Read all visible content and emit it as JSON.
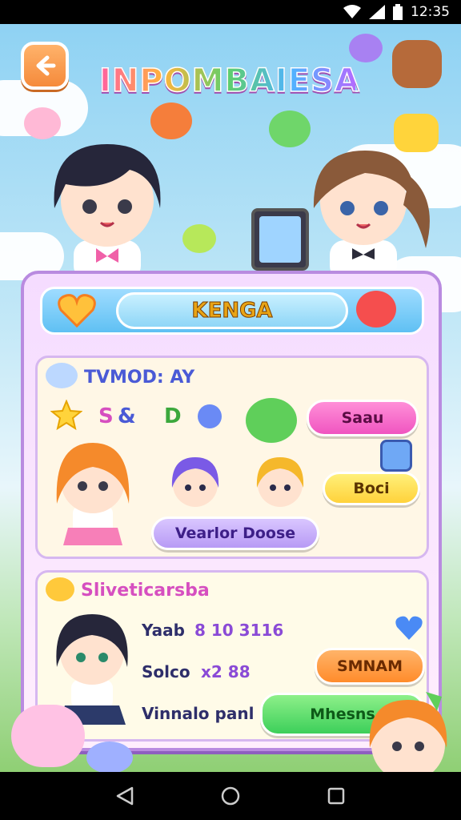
{
  "status_bar": {
    "time": "12:35"
  },
  "header": {
    "title": "INPOMBAIESA"
  },
  "name_banner": {
    "name": "KENGA"
  },
  "team_card": {
    "heading": "TVMOD: AY",
    "symbols": [
      "S",
      "&",
      "D"
    ],
    "sell_button": "Saau",
    "boost_button": "Boci",
    "action_button": "Vearlor Doose"
  },
  "profile_card": {
    "heading": "Sliveticarsba",
    "row1_label": "Yaab",
    "row1_value": "8 10 3116",
    "row2_label": "Solco",
    "row2_value": "x2 88",
    "row3_label": "Vinnalo panl",
    "orange_button": "SMNAM",
    "green_button": "Mhesns"
  },
  "colors": {
    "accent": "#b98be0",
    "sky": "#8fd2f3",
    "grass": "#8fcf74"
  },
  "icons": [
    "back-arrow-icon",
    "heart-icon",
    "star-icon",
    "signal-icon",
    "battery-icon",
    "nav-back-icon",
    "nav-home-icon",
    "nav-recents-icon"
  ]
}
